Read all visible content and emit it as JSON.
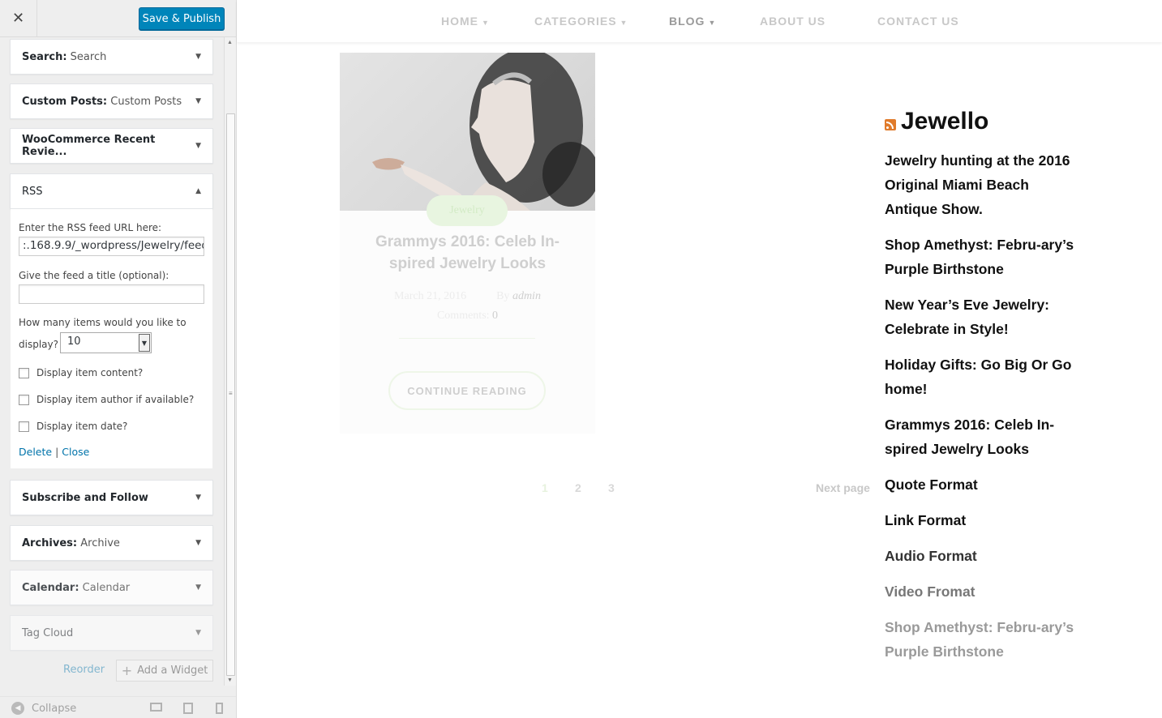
{
  "customizer": {
    "close_glyph": "✕",
    "publish_label": "Save & Publish",
    "widgets_top": [
      {
        "title": "Search:",
        "subtitle": "Search"
      },
      {
        "title": "Custom Posts:",
        "subtitle": "Custom Posts"
      },
      {
        "title": "WooCommerce Recent Revie...",
        "subtitle": ""
      },
      {
        "title": "RSS",
        "subtitle": ""
      }
    ],
    "rss_form": {
      "url_label": "Enter the RSS feed URL here:",
      "url_value": ":.168.9.9/_wordpress/Jewelry/feed",
      "title_label": "Give the feed a title (optional):",
      "title_value": "",
      "items_label_1": "How many items would you like to",
      "items_label_2": "display?",
      "items_value": "10",
      "show_content_label": "Display item content?",
      "show_author_label": "Display item author if available?",
      "show_date_label": "Display item date?",
      "delete_label": "Delete",
      "separator": "|",
      "close_label": "Close"
    },
    "widgets_bottom": [
      {
        "title": "Subscribe and Follow",
        "subtitle": ""
      },
      {
        "title": "Archives:",
        "subtitle": "Archive"
      },
      {
        "title": "Calendar:",
        "subtitle": "Calendar"
      },
      {
        "title": "Tag Cloud",
        "subtitle": ""
      }
    ],
    "reorder_label": "Reorder",
    "add_widget_label": "Add a Widget",
    "collapse_label": "Collapse"
  },
  "preview": {
    "nav": [
      "HOME",
      "CATEGORIES",
      "BLOG",
      "ABOUT US",
      "CONTACT US"
    ],
    "post": {
      "category": "Jewelry",
      "title": "Grammys 2016: Celeb In-spired Jewelry Looks",
      "date": "March 21, 2016",
      "by": "By",
      "author": "admin",
      "comments_label": "Comments:",
      "comments_count": "0",
      "continue_label": "CONTINUE READING"
    },
    "pagination": {
      "pages": [
        "1",
        "2",
        "3"
      ],
      "next_label": "Next page"
    },
    "rss_widget": {
      "title": "Jewello",
      "items": [
        "Jewelry hunting at the 2016 Original Miami Beach Antique Show.",
        "Shop Amethyst: Febru-ary’s Purple Birthstone",
        "New Year’s Eve Jewelry: Celebrate in Style!",
        "Holiday Gifts: Go Big Or Go home!",
        "Grammys 2016: Celeb In-spired Jewelry Looks",
        "Quote Format",
        "Link Format",
        "Audio Format",
        "Video Fromat",
        "Shop Amethyst: Febru-ary’s Purple Birthstone"
      ]
    }
  }
}
